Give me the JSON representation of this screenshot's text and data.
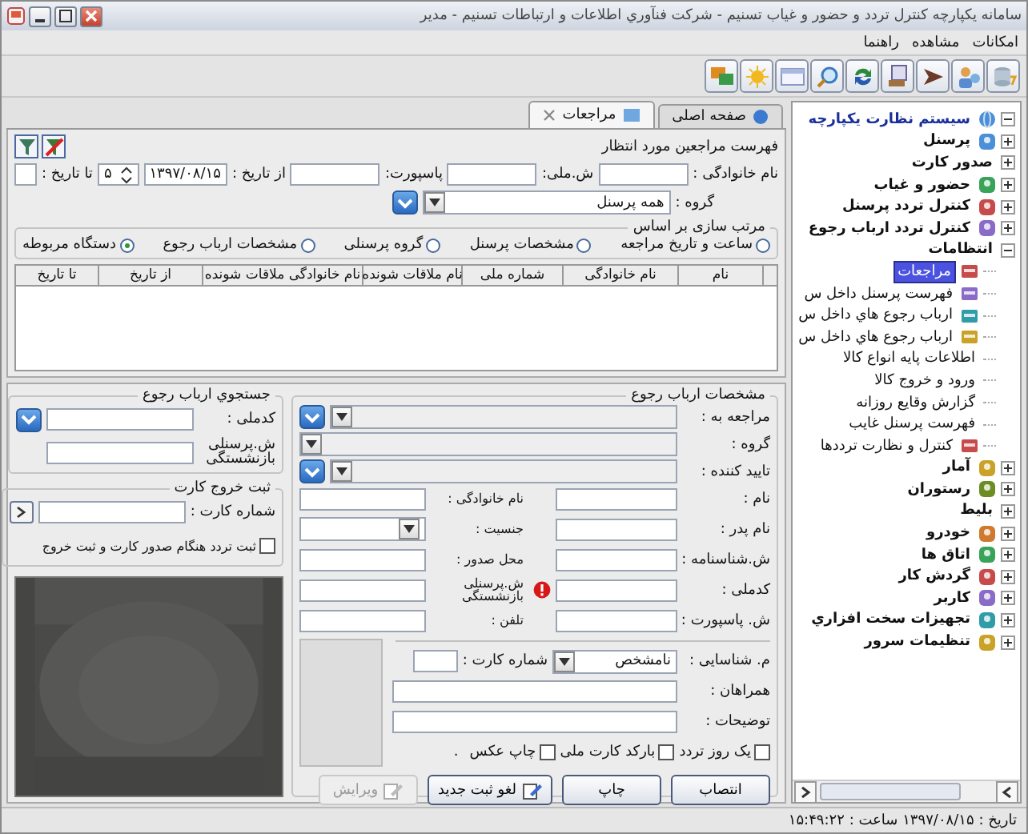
{
  "window": {
    "title": "سامانه یکپارچه کنترل تردد و حضور و غیاب تسنیم - شرکت فنآوري اطلاعات و ارتباطات تسنیم - مدیر"
  },
  "menu": [
    {
      "label": "امکانات"
    },
    {
      "label": "مشاهده"
    },
    {
      "label": "راهنما"
    }
  ],
  "tabs": [
    {
      "label": "صفحه اصلی",
      "selected": false,
      "closable": false
    },
    {
      "label": "مراجعات",
      "selected": true,
      "closable": true
    }
  ],
  "waiting_list": {
    "title": "فهرست مراجعین مورد انتظار",
    "filters": [
      {
        "label": "نام خانوادگی :"
      },
      {
        "label": "ش.ملی:"
      },
      {
        "label": "پاسپورت:"
      }
    ],
    "from_date": {
      "label": "از تاریخ :",
      "value": "۱۳۹۷/۰۸/۱۵"
    },
    "days": "۵",
    "to_date": {
      "label": "تا تاریخ :"
    },
    "group": {
      "label": "گروه :",
      "value": "همه پرسنل"
    }
  },
  "sort": {
    "title": "مرتب سازی بر اساس",
    "options": [
      {
        "label": "ساعت و تاریخ مراجعه",
        "selected": false
      },
      {
        "label": "مشخصات پرسنل",
        "selected": false
      },
      {
        "label": "گروه پرسنلی",
        "selected": false
      },
      {
        "label": "مشخصات ارباب رجوع",
        "selected": false
      },
      {
        "label": "دستگاه مربوطه",
        "selected": true
      }
    ]
  },
  "table": {
    "columns": [
      "نام",
      "نام خانوادگی",
      "شماره ملی",
      "نام ملاقات شونده",
      "نام خانوادگی ملاقات شونده",
      "از تاریخ",
      "تا تاریخ"
    ]
  },
  "visitor_search": {
    "title": "جستجوي ارباب رجوع",
    "fields": [
      {
        "label": "کدملی :"
      },
      {
        "label": "ش.پرسنلی بازنشستگی"
      }
    ]
  },
  "card_exit": {
    "title": "ثبت خروج کارت",
    "card_label": "شماره کارت :",
    "option": {
      "label": "ثبت تردد هنگام صدور کارت و ثبت خروج",
      "checked": false
    }
  },
  "visitor_details": {
    "title": "مشخصات ارباب رجوع",
    "selects": [
      {
        "label": "مراجعه به :",
        "lookup": true
      },
      {
        "label": "گروه :",
        "lookup": false
      },
      {
        "label": "تایید کننده :",
        "lookup": true
      }
    ],
    "fields": [
      {
        "label": "نام :",
        "kind": "text",
        "warning": false
      },
      {
        "label": "نام خانوادگی :",
        "kind": "text",
        "warning": false
      },
      {
        "label": "نام پدر :",
        "kind": "text",
        "warning": false
      },
      {
        "label": "جنسیت :",
        "kind": "select",
        "warning": false
      },
      {
        "label": "ش.شناسنامه :",
        "kind": "text",
        "warning": false
      },
      {
        "label": "محل صدور :",
        "kind": "text",
        "warning": false
      },
      {
        "label": "کدملی :",
        "kind": "text",
        "warning": true
      },
      {
        "label": "ش.پرسنلی بازنشستگی",
        "kind": "text",
        "warning": false
      },
      {
        "label": "ش. پاسپورت :",
        "kind": "text",
        "warning": false
      },
      {
        "label": "تلفن :",
        "kind": "text",
        "warning": false
      }
    ],
    "id_type": {
      "label": "م. شناسایی :",
      "value": "نامشخص"
    },
    "card_number": {
      "label": "شماره کارت :"
    },
    "companions": {
      "label": "همراهان :"
    },
    "notes": {
      "label": "توضیحات :"
    },
    "options": [
      {
        "label": "یک روز تردد",
        "checked": false
      },
      {
        "label": "بارکد کارت ملی",
        "checked": false
      },
      {
        "label": "چاپ عکس",
        "checked": false
      }
    ],
    "mark": ".",
    "buttons": [
      {
        "label": "انتصاب",
        "kind": "plain",
        "disabled": false
      },
      {
        "label": "چاپ",
        "kind": "plain",
        "disabled": false
      },
      {
        "label": "لغو ثبت جدید",
        "kind": "icon",
        "disabled": false
      },
      {
        "label": "ویرایش",
        "kind": "icon",
        "disabled": true
      }
    ]
  },
  "tree": {
    "label": "سیستم نظارت یکپارچه",
    "expanded": true,
    "icon": true,
    "selected": false,
    "children": [
      {
        "label": "پرسنل",
        "expanded": false,
        "icon": true,
        "selected": false
      },
      {
        "label": "صدور کارت",
        "expanded": false,
        "icon": false,
        "selected": false
      },
      {
        "label": "حضور و غیاب",
        "expanded": false,
        "icon": true,
        "selected": false
      },
      {
        "label": "کنترل تردد پرسنل",
        "expanded": false,
        "icon": true,
        "selected": false
      },
      {
        "label": "کنترل تردد ارباب رجوع",
        "expanded": false,
        "icon": true,
        "selected": false
      },
      {
        "label": "انتظامات",
        "expanded": true,
        "icon": false,
        "selected": false,
        "children": [
          {
            "label": "مراجعات",
            "icon": true,
            "selected": true
          },
          {
            "label": "فهرست پرسنل داخل س",
            "icon": true,
            "selected": false
          },
          {
            "label": "ارباب رجوع هاي داخل س",
            "icon": true,
            "selected": false
          },
          {
            "label": "ارباب رجوع هاي داخل س",
            "icon": true,
            "selected": false
          },
          {
            "label": "اطلاعات پایه انواع کالا",
            "icon": false,
            "selected": false
          },
          {
            "label": "ورود و خروج کالا",
            "icon": false,
            "selected": false
          },
          {
            "label": "گزارش وقایع روزانه",
            "icon": false,
            "selected": false
          },
          {
            "label": "فهرست پرسنل غایب",
            "icon": false,
            "selected": false
          },
          {
            "label": "کنترل و نظارت ترددها",
            "icon": true,
            "selected": false
          }
        ]
      },
      {
        "label": "آمار",
        "expanded": false,
        "icon": true,
        "selected": false
      },
      {
        "label": "رستوران",
        "expanded": false,
        "icon": true,
        "selected": false
      },
      {
        "label": "بلیط",
        "expanded": false,
        "icon": false,
        "selected": false
      },
      {
        "label": "خودرو",
        "expanded": false,
        "icon": true,
        "selected": false
      },
      {
        "label": "اتاق ها",
        "expanded": false,
        "icon": true,
        "selected": false
      },
      {
        "label": "گردش کار",
        "expanded": false,
        "icon": true,
        "selected": false
      },
      {
        "label": "کاربر",
        "expanded": false,
        "icon": true,
        "selected": false
      },
      {
        "label": "تجهیزات سخت افزاري",
        "expanded": false,
        "icon": true,
        "selected": false
      },
      {
        "label": "تنظیمات سرور",
        "expanded": false,
        "icon": true,
        "selected": false
      }
    ]
  },
  "status_bar": {
    "text": "تاریخ : ۱۳۹۷/۰۸/۱۵ ساعت : ۱۵:۴۹:۲۲"
  }
}
